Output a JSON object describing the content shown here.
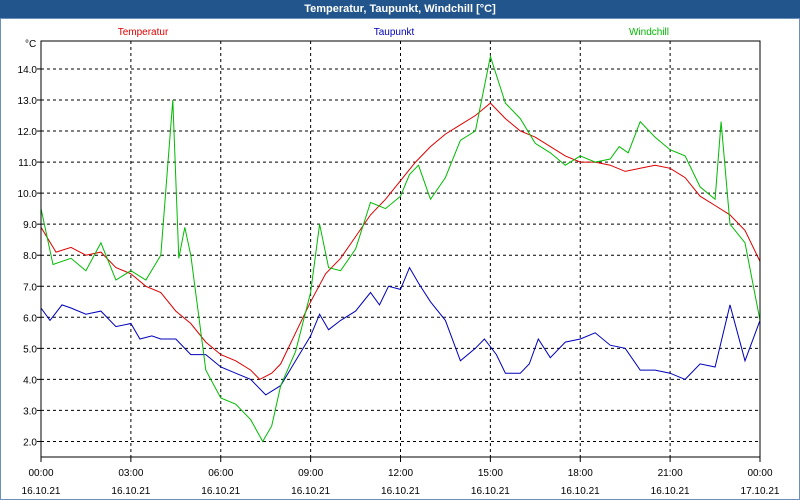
{
  "window_title": "Temperatur, Taupunkt, Windchill [°C]",
  "colors": {
    "title_bar": "#22558c",
    "temperatur": "#dd0000",
    "taupunkt": "#0000bb",
    "windchill": "#00bb00",
    "grid": "#000000"
  },
  "chart_data": {
    "type": "line",
    "title": "Temperatur, Taupunkt, Windchill [°C]",
    "ylabel": "°C",
    "ylim": [
      1.5,
      14.9
    ],
    "yticks": [
      "2.0",
      "3.0",
      "4.0",
      "5.0",
      "6.0",
      "7.0",
      "8.0",
      "9.0",
      "10.0",
      "11.0",
      "12.0",
      "13.0",
      "14.0"
    ],
    "xlim": [
      0,
      24
    ],
    "xticks": [
      {
        "time": "00:00",
        "date": "16.10.21"
      },
      {
        "time": "03:00",
        "date": "16.10.21"
      },
      {
        "time": "06:00",
        "date": "16.10.21"
      },
      {
        "time": "09:00",
        "date": "16.10.21"
      },
      {
        "time": "12:00",
        "date": "16.10.21"
      },
      {
        "time": "15:00",
        "date": "16.10.21"
      },
      {
        "time": "18:00",
        "date": "16.10.21"
      },
      {
        "time": "21:00",
        "date": "16.10.21"
      },
      {
        "time": "00:00",
        "date": "17.10.21"
      }
    ],
    "grid": true,
    "x_unit": "hours since 16.10.21 00:00",
    "series": [
      {
        "name": "Temperatur",
        "color": "#dd0000",
        "points": [
          [
            0,
            8.9
          ],
          [
            0.5,
            8.1
          ],
          [
            1,
            8.25
          ],
          [
            1.5,
            8.0
          ],
          [
            2,
            8.1
          ],
          [
            2.5,
            7.6
          ],
          [
            3,
            7.4
          ],
          [
            3.5,
            7.0
          ],
          [
            4,
            6.8
          ],
          [
            4.5,
            6.2
          ],
          [
            5,
            5.8
          ],
          [
            5.5,
            5.2
          ],
          [
            6,
            4.8
          ],
          [
            6.5,
            4.6
          ],
          [
            7,
            4.3
          ],
          [
            7.3,
            4.0
          ],
          [
            7.7,
            4.2
          ],
          [
            8,
            4.5
          ],
          [
            8.5,
            5.5
          ],
          [
            9,
            6.5
          ],
          [
            9.5,
            7.4
          ],
          [
            10,
            7.9
          ],
          [
            10.5,
            8.6
          ],
          [
            11,
            9.3
          ],
          [
            11.5,
            9.8
          ],
          [
            12,
            10.4
          ],
          [
            12.5,
            11.0
          ],
          [
            13,
            11.5
          ],
          [
            13.5,
            11.9
          ],
          [
            14,
            12.2
          ],
          [
            14.5,
            12.5
          ],
          [
            15,
            12.9
          ],
          [
            15.5,
            12.4
          ],
          [
            16,
            12.0
          ],
          [
            16.5,
            11.8
          ],
          [
            17,
            11.5
          ],
          [
            17.5,
            11.2
          ],
          [
            18,
            11.0
          ],
          [
            18.5,
            11.0
          ],
          [
            19,
            10.9
          ],
          [
            19.5,
            10.7
          ],
          [
            20,
            10.8
          ],
          [
            20.5,
            10.9
          ],
          [
            21,
            10.8
          ],
          [
            21.5,
            10.5
          ],
          [
            22,
            9.9
          ],
          [
            22.5,
            9.6
          ],
          [
            23,
            9.3
          ],
          [
            23.5,
            8.8
          ],
          [
            24,
            7.8
          ]
        ]
      },
      {
        "name": "Taupunkt",
        "color": "#0000bb",
        "points": [
          [
            0,
            6.3
          ],
          [
            0.3,
            5.9
          ],
          [
            0.7,
            6.4
          ],
          [
            1,
            6.3
          ],
          [
            1.5,
            6.1
          ],
          [
            2,
            6.2
          ],
          [
            2.5,
            5.7
          ],
          [
            3,
            5.8
          ],
          [
            3.3,
            5.3
          ],
          [
            3.7,
            5.4
          ],
          [
            4,
            5.3
          ],
          [
            4.5,
            5.3
          ],
          [
            5,
            4.8
          ],
          [
            5.5,
            4.8
          ],
          [
            6,
            4.4
          ],
          [
            6.5,
            4.2
          ],
          [
            7,
            4.0
          ],
          [
            7.5,
            3.5
          ],
          [
            8,
            3.8
          ],
          [
            8.5,
            4.6
          ],
          [
            9,
            5.4
          ],
          [
            9.3,
            6.1
          ],
          [
            9.6,
            5.6
          ],
          [
            10,
            5.9
          ],
          [
            10.5,
            6.2
          ],
          [
            11,
            6.8
          ],
          [
            11.3,
            6.4
          ],
          [
            11.6,
            7.0
          ],
          [
            12,
            6.9
          ],
          [
            12.3,
            7.6
          ],
          [
            12.6,
            7.1
          ],
          [
            13,
            6.5
          ],
          [
            13.5,
            5.9
          ],
          [
            14,
            4.6
          ],
          [
            14.5,
            5.0
          ],
          [
            14.8,
            5.3
          ],
          [
            15.2,
            4.8
          ],
          [
            15.5,
            4.2
          ],
          [
            16,
            4.2
          ],
          [
            16.3,
            4.5
          ],
          [
            16.6,
            5.3
          ],
          [
            17,
            4.7
          ],
          [
            17.5,
            5.2
          ],
          [
            18,
            5.3
          ],
          [
            18.5,
            5.5
          ],
          [
            19,
            5.1
          ],
          [
            19.5,
            5.0
          ],
          [
            20,
            4.3
          ],
          [
            20.5,
            4.3
          ],
          [
            21,
            4.2
          ],
          [
            21.5,
            4.0
          ],
          [
            22,
            4.5
          ],
          [
            22.5,
            4.4
          ],
          [
            23,
            6.4
          ],
          [
            23.5,
            4.6
          ],
          [
            24,
            5.9
          ]
        ]
      },
      {
        "name": "Windchill",
        "color": "#00bb00",
        "points": [
          [
            0,
            9.5
          ],
          [
            0.4,
            7.7
          ],
          [
            1,
            7.9
          ],
          [
            1.5,
            7.5
          ],
          [
            2,
            8.4
          ],
          [
            2.5,
            7.2
          ],
          [
            3,
            7.5
          ],
          [
            3.5,
            7.2
          ],
          [
            4,
            8.0
          ],
          [
            4.4,
            13.0
          ],
          [
            4.6,
            7.9
          ],
          [
            4.8,
            8.9
          ],
          [
            5,
            8.0
          ],
          [
            5.5,
            4.3
          ],
          [
            6,
            3.4
          ],
          [
            6.5,
            3.2
          ],
          [
            7,
            2.7
          ],
          [
            7.4,
            2.0
          ],
          [
            7.7,
            2.5
          ],
          [
            8,
            3.8
          ],
          [
            8.5,
            4.9
          ],
          [
            9,
            6.8
          ],
          [
            9.3,
            9.0
          ],
          [
            9.6,
            7.6
          ],
          [
            10,
            7.5
          ],
          [
            10.5,
            8.2
          ],
          [
            11,
            9.7
          ],
          [
            11.5,
            9.5
          ],
          [
            12,
            9.9
          ],
          [
            12.3,
            10.6
          ],
          [
            12.6,
            10.9
          ],
          [
            13,
            9.8
          ],
          [
            13.5,
            10.5
          ],
          [
            14,
            11.7
          ],
          [
            14.5,
            12.0
          ],
          [
            15,
            14.4
          ],
          [
            15.5,
            12.9
          ],
          [
            16,
            12.4
          ],
          [
            16.5,
            11.6
          ],
          [
            17,
            11.3
          ],
          [
            17.5,
            10.9
          ],
          [
            18,
            11.2
          ],
          [
            18.5,
            11.0
          ],
          [
            19,
            11.1
          ],
          [
            19.3,
            11.5
          ],
          [
            19.6,
            11.3
          ],
          [
            20,
            12.3
          ],
          [
            20.5,
            11.8
          ],
          [
            21,
            11.4
          ],
          [
            21.5,
            11.2
          ],
          [
            22,
            10.2
          ],
          [
            22.5,
            9.8
          ],
          [
            22.7,
            12.3
          ],
          [
            23,
            9.0
          ],
          [
            23.5,
            8.4
          ],
          [
            24,
            5.9
          ]
        ]
      }
    ]
  }
}
